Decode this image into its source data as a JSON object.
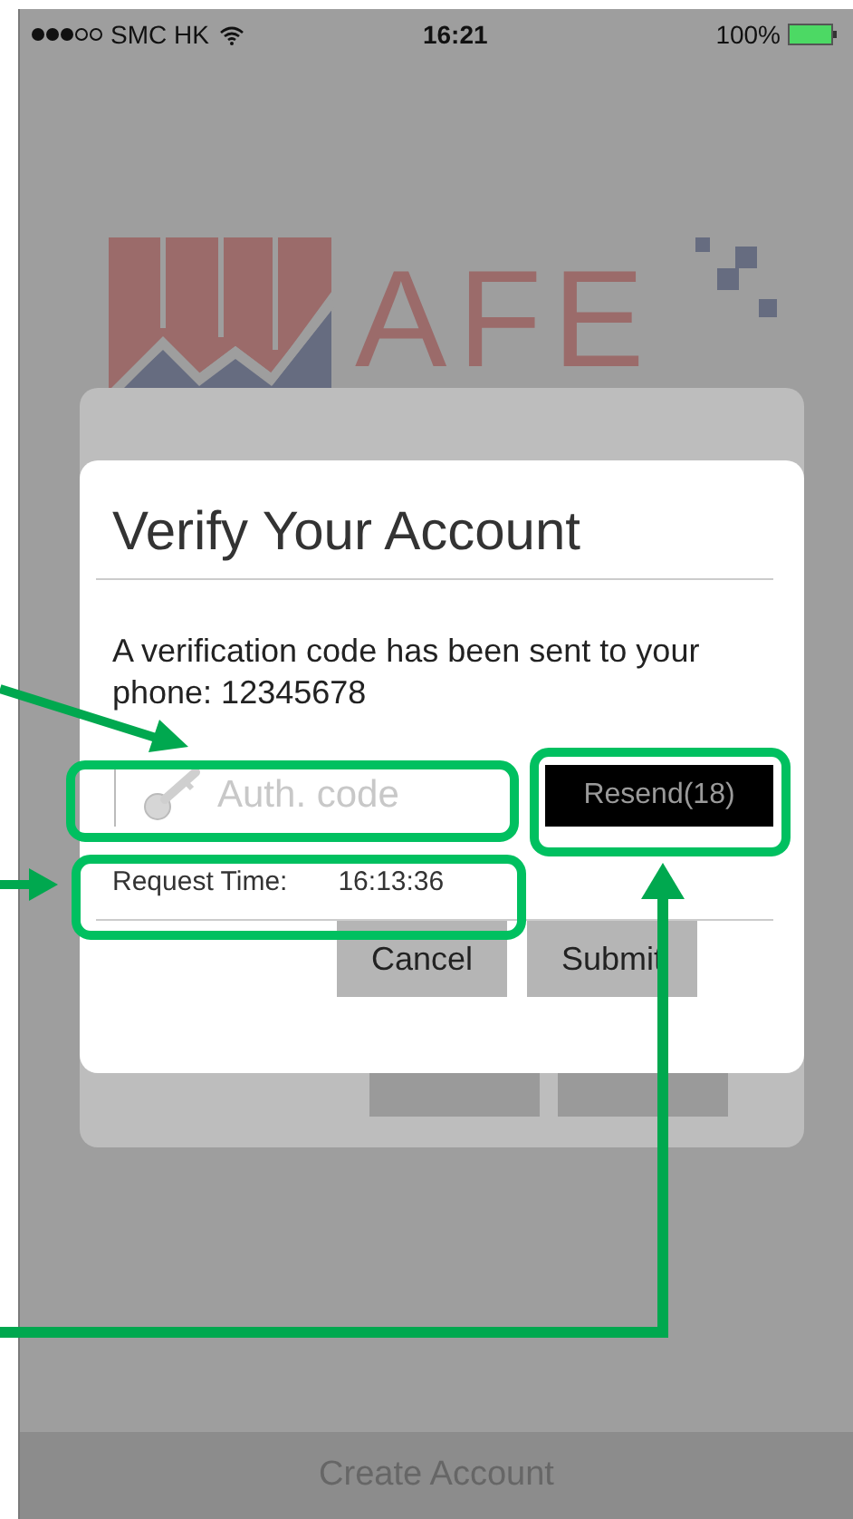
{
  "status_bar": {
    "carrier": "SMC HK",
    "time": "16:21",
    "battery": "100%"
  },
  "logo": {
    "name": "AFE"
  },
  "dialog": {
    "title": "Verify Your Account",
    "message": "A verification code has been sent to your phone: 12345678",
    "code_field": {
      "placeholder": "Auth. code"
    },
    "resend_button": "Resend(18)",
    "request_time": {
      "label": "Request Time:",
      "value": "16:13:36"
    },
    "buttons": [
      "Cancel",
      "Submit"
    ]
  },
  "bottom_bar": {
    "title": "Create Account"
  }
}
